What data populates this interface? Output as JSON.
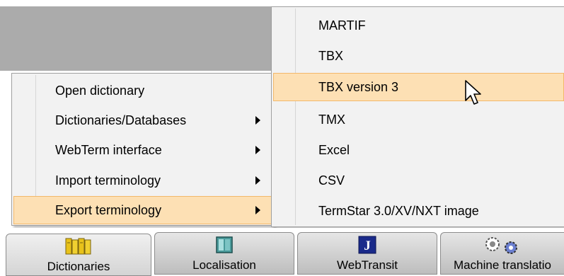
{
  "left_menu": {
    "items": [
      {
        "label": "Open dictionary",
        "has_submenu": false
      },
      {
        "label": "Dictionaries/Databases",
        "has_submenu": true
      },
      {
        "label": "WebTerm interface",
        "has_submenu": true
      },
      {
        "label": "Import terminology",
        "has_submenu": true
      },
      {
        "label": "Export terminology",
        "has_submenu": true,
        "highlighted": true
      }
    ]
  },
  "export_submenu": {
    "items": [
      {
        "label": "MARTIF"
      },
      {
        "label": "TBX"
      },
      {
        "label": "TBX version 3",
        "highlighted": true
      },
      {
        "label": "TMX"
      },
      {
        "label": "Excel"
      },
      {
        "label": "CSV"
      },
      {
        "label": "TermStar 3.0/XV/NXT image"
      }
    ]
  },
  "taskbar": {
    "buttons": [
      {
        "label": "Dictionaries",
        "icon": "dictionaries-icon"
      },
      {
        "label": "Localisation",
        "icon": "localisation-icon"
      },
      {
        "label": "WebTransit",
        "icon": "webtransit-icon"
      },
      {
        "label": "Machine translatio",
        "icon": "gears-icon"
      }
    ]
  },
  "colors": {
    "highlight_fill": "#fde0b4",
    "highlight_border": "#f3b86a",
    "menu_bg": "#f2f2f2",
    "top_gray": "#ababab"
  }
}
